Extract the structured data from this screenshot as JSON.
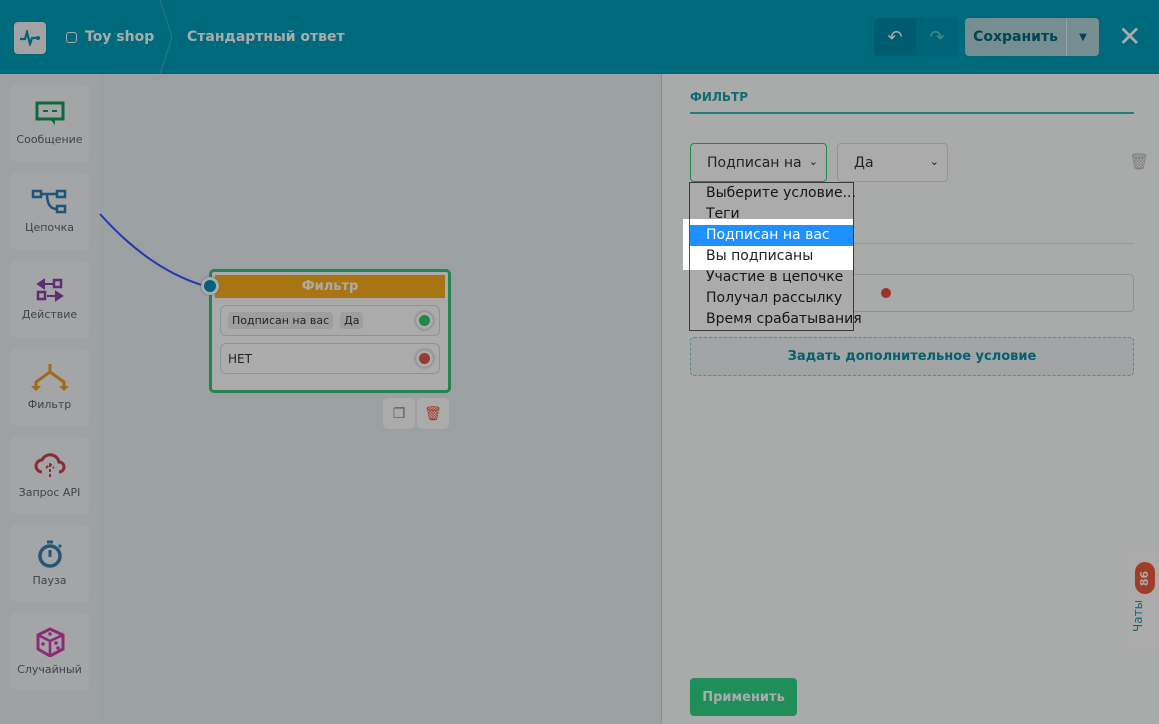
{
  "header": {
    "shop": "Toy shop",
    "breadcrumb": "Стандартный ответ",
    "save_label": "Сохранить"
  },
  "sidebar": {
    "items": [
      {
        "label": "Сообщение",
        "color": "#1a9a5a"
      },
      {
        "label": "Цепочка",
        "color": "#2a7fb5"
      },
      {
        "label": "Действие",
        "color": "#8e44ad"
      },
      {
        "label": "Фильтр",
        "color": "#f0a020"
      },
      {
        "label": "Запрос API",
        "color": "#d04050"
      },
      {
        "label": "Пауза",
        "color": "#3a7fb0"
      },
      {
        "label": "Случайный",
        "color": "#d040b0"
      }
    ]
  },
  "node": {
    "title": "Фильтр",
    "condition": "Подписан  на  вас",
    "value": "Да",
    "no_label": "НЕТ"
  },
  "panel": {
    "title": "ФИЛЬТР",
    "condition_select": "Подписан на",
    "value_select": "Да",
    "add_condition": "Задать дополнительное условие",
    "apply": "Применить"
  },
  "dropdown": {
    "options": [
      "Выберите условие...",
      "Теги",
      "Подписан на вас",
      "Вы подписаны",
      "Участие в цепочке",
      "Получал рассылку",
      "Время срабатывания"
    ],
    "selected": "Подписан на вас"
  },
  "chats": {
    "label": "Чаты",
    "count": "86"
  }
}
